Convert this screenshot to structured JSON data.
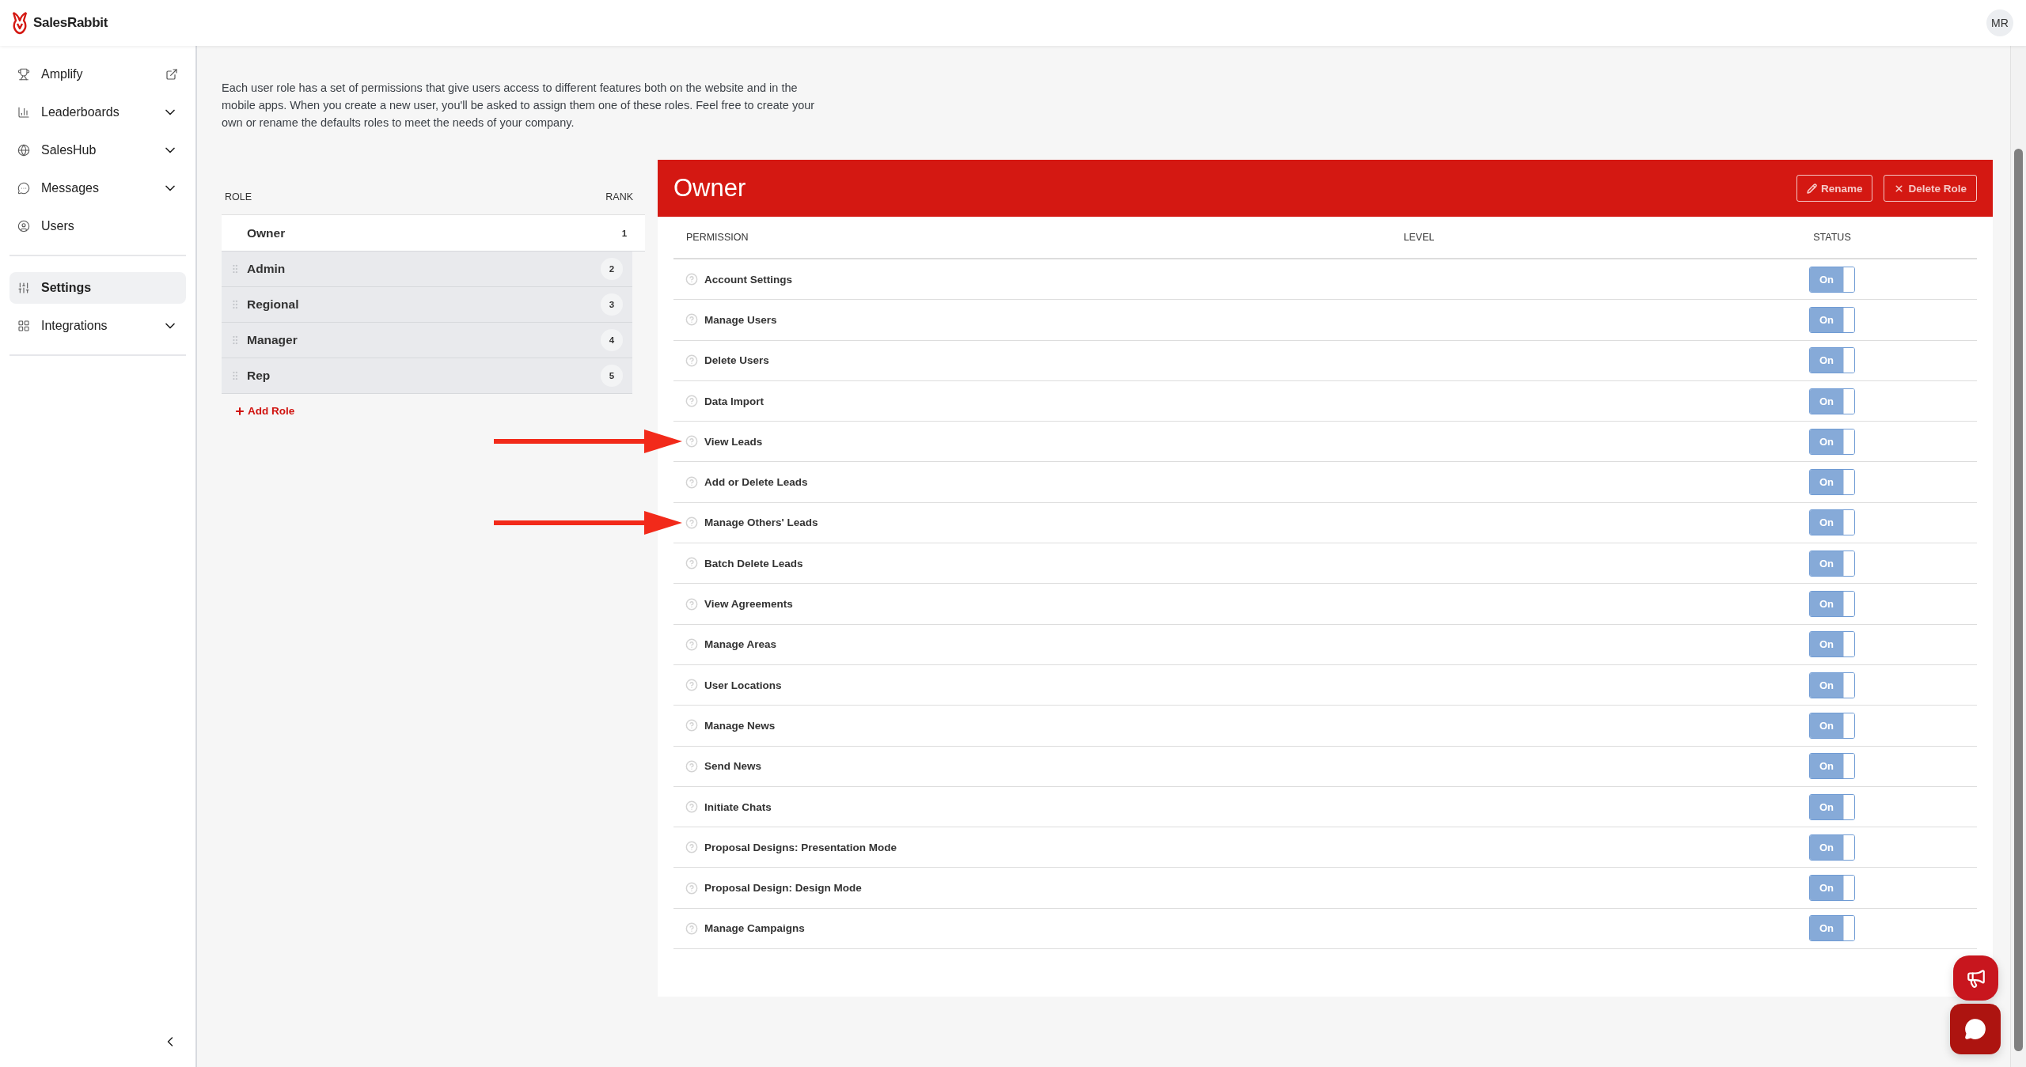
{
  "header": {
    "brand": "SalesRabbit",
    "avatar": "MR"
  },
  "sidebar": {
    "groups": [
      [
        {
          "label": "Amplify",
          "kind": "external",
          "selected": false
        },
        {
          "label": "Leaderboards",
          "kind": "menu",
          "selected": false
        },
        {
          "label": "SalesHub",
          "kind": "menu",
          "selected": false
        },
        {
          "label": "Messages",
          "kind": "menu",
          "selected": false
        },
        {
          "label": "Users",
          "kind": "link",
          "selected": false
        }
      ],
      [
        {
          "label": "Settings",
          "kind": "link",
          "selected": true
        },
        {
          "label": "Integrations",
          "kind": "menu",
          "selected": false
        }
      ]
    ]
  },
  "description": "Each user role has a set of permissions that give users access to different features both on the website and in the mobile apps. When you create a new user, you'll be asked to assign them one of these roles. Feel free to create your own or rename the defaults roles to meet the needs of your company.",
  "roles": {
    "columns": [
      "ROLE",
      "RANK"
    ],
    "items": [
      {
        "name": "Owner",
        "rank": "1",
        "selected": true
      },
      {
        "name": "Admin",
        "rank": "2",
        "selected": false
      },
      {
        "name": "Regional",
        "rank": "3",
        "selected": false
      },
      {
        "name": "Manager",
        "rank": "4",
        "selected": false
      },
      {
        "name": "Rep",
        "rank": "5",
        "selected": false
      }
    ],
    "add_label": "Add Role"
  },
  "panel": {
    "title": "Owner",
    "buttons": [
      {
        "label": "Rename",
        "kind": "rename"
      },
      {
        "label": "Delete Role",
        "kind": "delete"
      }
    ],
    "columns": [
      "PERMISSION",
      "LEVEL",
      "STATUS"
    ],
    "permissions": [
      {
        "name": "Account Settings",
        "status": "On",
        "on": true,
        "annotated": false
      },
      {
        "name": "Manage Users",
        "status": "On",
        "on": true,
        "annotated": false
      },
      {
        "name": "Delete Users",
        "status": "On",
        "on": true,
        "annotated": false
      },
      {
        "name": "Data Import",
        "status": "On",
        "on": true,
        "annotated": false
      },
      {
        "name": "View Leads",
        "status": "On",
        "on": true,
        "annotated": true
      },
      {
        "name": "Add or Delete Leads",
        "status": "On",
        "on": true,
        "annotated": false
      },
      {
        "name": "Manage Others' Leads",
        "status": "On",
        "on": true,
        "annotated": true
      },
      {
        "name": "Batch Delete Leads",
        "status": "On",
        "on": true,
        "annotated": false
      },
      {
        "name": "View Agreements",
        "status": "On",
        "on": true,
        "annotated": false
      },
      {
        "name": "Manage Areas",
        "status": "On",
        "on": true,
        "annotated": false
      },
      {
        "name": "User Locations",
        "status": "On",
        "on": true,
        "annotated": false
      },
      {
        "name": "Manage News",
        "status": "On",
        "on": true,
        "annotated": false
      },
      {
        "name": "Send News",
        "status": "On",
        "on": true,
        "annotated": false
      },
      {
        "name": "Initiate Chats",
        "status": "On",
        "on": true,
        "annotated": false
      },
      {
        "name": "Proposal Designs: Presentation Mode",
        "status": "On",
        "on": true,
        "annotated": false
      },
      {
        "name": "Proposal Design: Design Mode",
        "status": "On",
        "on": true,
        "annotated": false
      },
      {
        "name": "Manage Campaigns",
        "status": "On",
        "on": true,
        "annotated": false
      }
    ]
  }
}
